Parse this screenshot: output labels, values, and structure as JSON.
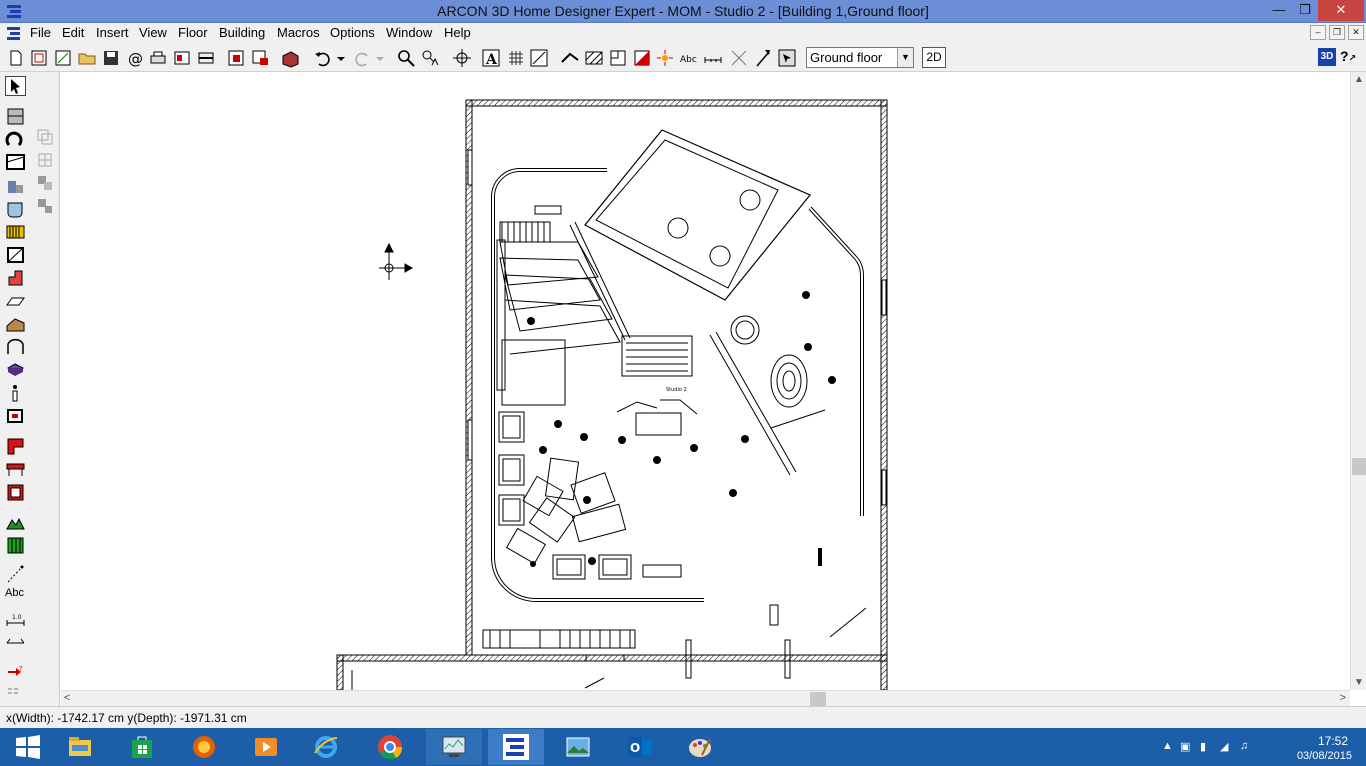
{
  "window": {
    "title": "ARCON 3D Home Designer Expert  - MOM - Studio 2 - [Building 1,Ground floor]",
    "minimize": "—",
    "restore": "❐",
    "close": "✕"
  },
  "menu": {
    "items": [
      "File",
      "Edit",
      "Insert",
      "View",
      "Floor",
      "Building",
      "Macros",
      "Options",
      "Window",
      "Help"
    ],
    "mdi": {
      "minimize": "–",
      "restore": "❐",
      "close": "✕"
    }
  },
  "toolbar": {
    "floor_select": "Ground floor",
    "btn_2d": "2D",
    "btn_3d": "3D",
    "help": "?"
  },
  "left_tools": {
    "text_tool_label": "Abc"
  },
  "plan": {
    "room_label": "Studio 2"
  },
  "status": {
    "coords": "x(Width): -1742.17 cm  y(Depth): -1971.31 cm"
  },
  "taskbar": {
    "apps": [
      "start-icon",
      "file-explorer-icon",
      "store-icon",
      "firefox-icon",
      "media-player-icon",
      "internet-explorer-icon",
      "chrome-icon",
      "system-monitor-icon",
      "arcon-icon",
      "photos-icon",
      "outlook-icon",
      "paint-icon"
    ],
    "time": "17:52",
    "date": "03/08/2015"
  }
}
